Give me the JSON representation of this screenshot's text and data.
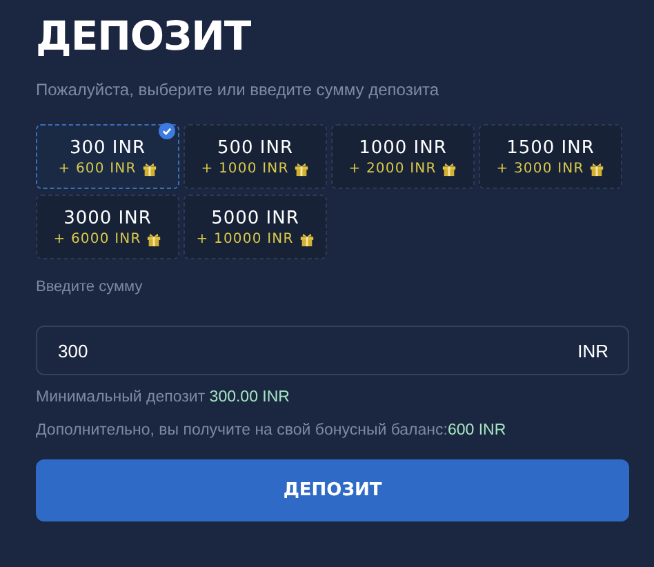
{
  "title": "ДЕПОЗИТ",
  "subtitle": "Пожалуйста, выберите или введите сумму депозита",
  "amounts": [
    {
      "amount": "300 INR",
      "bonus": "+ 600 INR",
      "selected": true
    },
    {
      "amount": "500 INR",
      "bonus": "+ 1000 INR",
      "selected": false
    },
    {
      "amount": "1000 INR",
      "bonus": "+ 2000 INR",
      "selected": false
    },
    {
      "amount": "1500 INR",
      "bonus": "+ 3000 INR",
      "selected": false
    },
    {
      "amount": "3000 INR",
      "bonus": "+ 6000 INR",
      "selected": false
    },
    {
      "amount": "5000 INR",
      "bonus": "+ 10000 INR",
      "selected": false
    }
  ],
  "amount_field": {
    "label": "Введите сумму",
    "value": "300",
    "currency": "INR"
  },
  "min_deposit": {
    "label": "Минимальный депозит",
    "value": "300.00 INR"
  },
  "bonus_info": {
    "label": "Дополнительно, вы получите на свой бонусный баланс:",
    "value": "600 INR"
  },
  "submit": "ДЕПОЗИТ"
}
